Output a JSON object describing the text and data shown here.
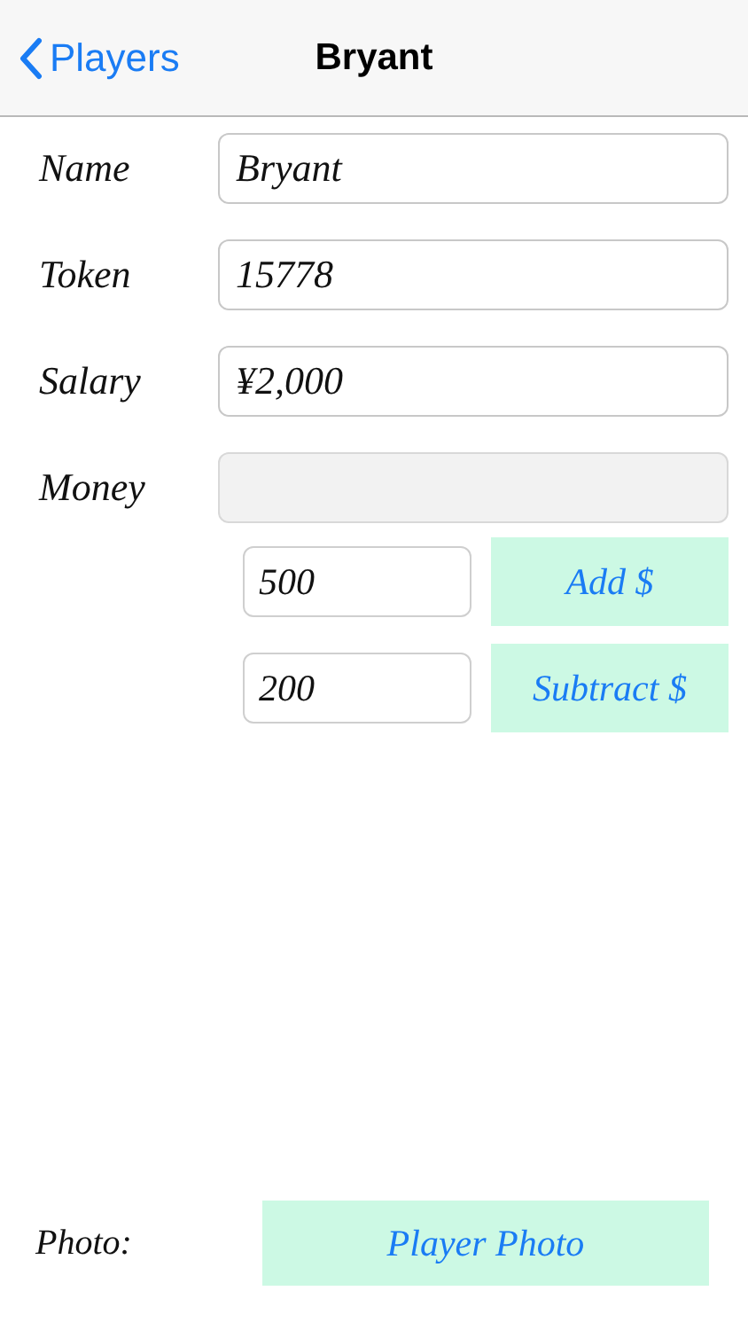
{
  "nav": {
    "back": "Players",
    "title": "Bryant"
  },
  "fields": [
    {
      "label": "Name",
      "value": "Bryant",
      "disabled": false
    },
    {
      "label": "Token",
      "value": "15778",
      "disabled": false
    },
    {
      "label": "Salary",
      "value": "¥2,000",
      "disabled": false
    },
    {
      "label": "Money",
      "disabled": true
    }
  ],
  "adjustments": [
    {
      "amount": "500",
      "button": "Add $"
    },
    {
      "amount": "200",
      "button": "Subtract $"
    }
  ],
  "photo": {
    "label": "Photo:",
    "button": "Player Photo"
  }
}
